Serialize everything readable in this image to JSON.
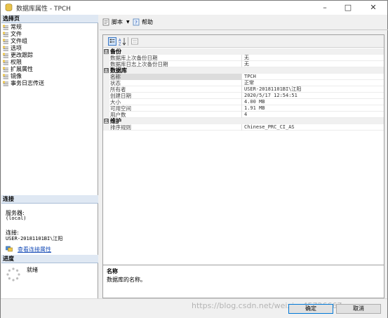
{
  "window": {
    "title": "数据库属性 - TPCH"
  },
  "left": {
    "select_page_header": "选择页",
    "pages": [
      {
        "label": "常规"
      },
      {
        "label": "文件"
      },
      {
        "label": "文件组"
      },
      {
        "label": "选项"
      },
      {
        "label": "更改跟踪"
      },
      {
        "label": "权限"
      },
      {
        "label": "扩展属性"
      },
      {
        "label": "镜像"
      },
      {
        "label": "事务日志传送"
      }
    ],
    "connection_header": "连接",
    "server_label": "服务器:",
    "server_value": "(local)",
    "connection_label": "连接:",
    "connection_value": "USER-20181101BI\\江阳",
    "view_connection_link": "查看连接属性",
    "progress_header": "进度",
    "progress_status": "就绪"
  },
  "toolbar": {
    "script_label": "脚本",
    "help_label": "帮助"
  },
  "grid": {
    "categories": [
      {
        "name": "备份",
        "toggle": "⊟",
        "rows": [
          {
            "name": "数据库上次备份日期",
            "value": "无"
          },
          {
            "name": "数据库日志上次备份日期",
            "value": "无"
          }
        ]
      },
      {
        "name": "数据库",
        "toggle": "⊟",
        "rows": [
          {
            "name": "名称",
            "value": "TPCH"
          },
          {
            "name": "状态",
            "value": "正常"
          },
          {
            "name": "所有者",
            "value": "USER-20181101BI\\江阳"
          },
          {
            "name": "创建日期",
            "value": "2020/5/17 12:54:51"
          },
          {
            "name": "大小",
            "value": "4.00 MB"
          },
          {
            "name": "可用空间",
            "value": "1.91 MB"
          },
          {
            "name": "用户数",
            "value": "4"
          }
        ]
      },
      {
        "name": "维护",
        "toggle": "⊟",
        "rows": [
          {
            "name": "排序规则",
            "value": "Chinese_PRC_CI_AS"
          }
        ]
      }
    ],
    "selected_row": "名称"
  },
  "description": {
    "title": "名称",
    "text": "数据库的名称。"
  },
  "buttons": {
    "ok": "确定",
    "cancel": "取消"
  },
  "watermark": "https://blog.csdn.net/weixin_45726667"
}
